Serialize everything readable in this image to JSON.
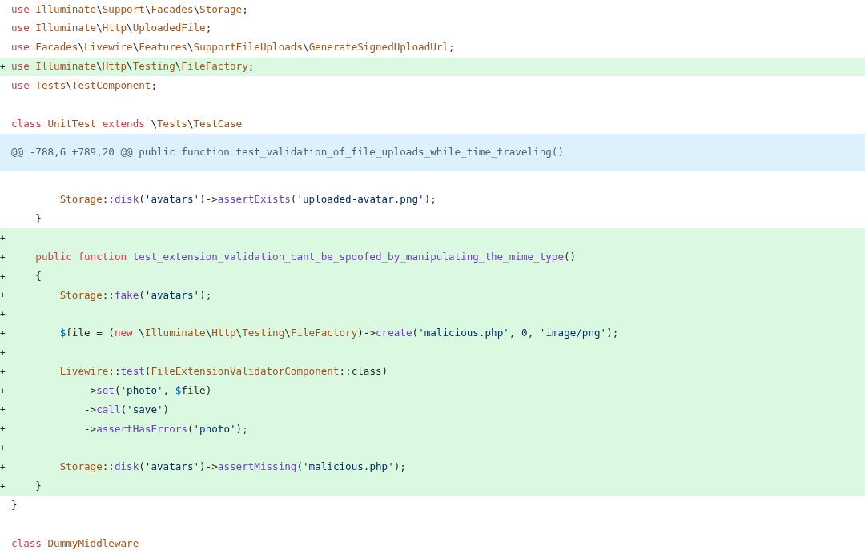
{
  "diff": {
    "lines": [
      {
        "kind": "context",
        "tokens": [
          {
            "kind": "kw",
            "text": "use"
          },
          {
            "kind": "type",
            "text": " Illuminate"
          },
          {
            "kind": "plain",
            "text": "\\"
          },
          {
            "kind": "type",
            "text": "Support"
          },
          {
            "kind": "plain",
            "text": "\\"
          },
          {
            "kind": "type",
            "text": "Facades"
          },
          {
            "kind": "plain",
            "text": "\\"
          },
          {
            "kind": "type",
            "text": "Storage"
          },
          {
            "kind": "plain",
            "text": ";"
          }
        ]
      },
      {
        "kind": "context",
        "tokens": [
          {
            "kind": "kw",
            "text": "use"
          },
          {
            "kind": "type",
            "text": " Illuminate"
          },
          {
            "kind": "plain",
            "text": "\\"
          },
          {
            "kind": "type",
            "text": "Http"
          },
          {
            "kind": "plain",
            "text": "\\"
          },
          {
            "kind": "type",
            "text": "UploadedFile"
          },
          {
            "kind": "plain",
            "text": ";"
          }
        ]
      },
      {
        "kind": "context",
        "tokens": [
          {
            "kind": "kw",
            "text": "use"
          },
          {
            "kind": "type",
            "text": " Facades"
          },
          {
            "kind": "plain",
            "text": "\\"
          },
          {
            "kind": "type",
            "text": "Livewire"
          },
          {
            "kind": "plain",
            "text": "\\"
          },
          {
            "kind": "type",
            "text": "Features"
          },
          {
            "kind": "plain",
            "text": "\\"
          },
          {
            "kind": "type",
            "text": "SupportFileUploads"
          },
          {
            "kind": "plain",
            "text": "\\"
          },
          {
            "kind": "type",
            "text": "GenerateSignedUploadUrl"
          },
          {
            "kind": "plain",
            "text": ";"
          }
        ]
      },
      {
        "kind": "added",
        "marker": "+",
        "tokens": [
          {
            "kind": "kw",
            "text": "use"
          },
          {
            "kind": "type",
            "text": " Illuminate"
          },
          {
            "kind": "plain",
            "text": "\\"
          },
          {
            "kind": "type",
            "text": "Http"
          },
          {
            "kind": "plain",
            "text": "\\"
          },
          {
            "kind": "type",
            "text": "Testing"
          },
          {
            "kind": "plain",
            "text": "\\"
          },
          {
            "kind": "type",
            "text": "FileFactory"
          },
          {
            "kind": "plain",
            "text": ";"
          }
        ]
      },
      {
        "kind": "context",
        "tokens": [
          {
            "kind": "kw",
            "text": "use"
          },
          {
            "kind": "type",
            "text": " Tests"
          },
          {
            "kind": "plain",
            "text": "\\"
          },
          {
            "kind": "type",
            "text": "TestComponent"
          },
          {
            "kind": "plain",
            "text": ";"
          }
        ]
      },
      {
        "kind": "context"
      },
      {
        "kind": "context",
        "tokens": [
          {
            "kind": "kw",
            "text": "class"
          },
          {
            "kind": "type",
            "text": " UnitTest"
          },
          {
            "kind": "kw",
            "text": " extends"
          },
          {
            "kind": "plain",
            "text": " \\"
          },
          {
            "kind": "type",
            "text": "Tests"
          },
          {
            "kind": "plain",
            "text": "\\"
          },
          {
            "kind": "type",
            "text": "TestCase"
          }
        ]
      },
      {
        "kind": "hunk",
        "tokens": [
          {
            "kind": "meta",
            "text": "@@ -788,6 +789,20 @@ public function test_validation_of_file_uploads_while_time_traveling()"
          }
        ]
      },
      {
        "kind": "context"
      },
      {
        "kind": "context",
        "tokens": [
          {
            "kind": "type",
            "text": "        Storage"
          },
          {
            "kind": "plain",
            "text": "::"
          },
          {
            "kind": "fn",
            "text": "disk"
          },
          {
            "kind": "plain",
            "text": "("
          },
          {
            "kind": "str",
            "text": "'avatars'"
          },
          {
            "kind": "plain",
            "text": ")->"
          },
          {
            "kind": "fn",
            "text": "assertExists"
          },
          {
            "kind": "plain",
            "text": "("
          },
          {
            "kind": "str",
            "text": "'uploaded-avatar.png'"
          },
          {
            "kind": "plain",
            "text": ");"
          }
        ]
      },
      {
        "kind": "context",
        "tokens": [
          {
            "kind": "plain",
            "text": "    }"
          }
        ]
      },
      {
        "kind": "added",
        "marker": "+"
      },
      {
        "kind": "added",
        "marker": "+",
        "tokens": [
          {
            "kind": "kw",
            "text": "    public"
          },
          {
            "kind": "kw",
            "text": " function"
          },
          {
            "kind": "fn",
            "text": " test_extension_validation_cant_be_spoofed_by_manipulating_the_mime_type"
          },
          {
            "kind": "plain",
            "text": "()"
          }
        ]
      },
      {
        "kind": "added",
        "marker": "+",
        "tokens": [
          {
            "kind": "plain",
            "text": "    {"
          }
        ]
      },
      {
        "kind": "added",
        "marker": "+",
        "tokens": [
          {
            "kind": "type",
            "text": "        Storage"
          },
          {
            "kind": "plain",
            "text": "::"
          },
          {
            "kind": "fn",
            "text": "fake"
          },
          {
            "kind": "plain",
            "text": "("
          },
          {
            "kind": "str",
            "text": "'avatars'"
          },
          {
            "kind": "plain",
            "text": ");"
          }
        ]
      },
      {
        "kind": "added",
        "marker": "+"
      },
      {
        "kind": "added",
        "marker": "+",
        "tokens": [
          {
            "kind": "var",
            "text": "        $"
          },
          {
            "kind": "plain",
            "text": "file = ("
          },
          {
            "kind": "kw",
            "text": "new"
          },
          {
            "kind": "plain",
            "text": " \\"
          },
          {
            "kind": "type",
            "text": "Illuminate"
          },
          {
            "kind": "plain",
            "text": "\\"
          },
          {
            "kind": "type",
            "text": "Http"
          },
          {
            "kind": "plain",
            "text": "\\"
          },
          {
            "kind": "type",
            "text": "Testing"
          },
          {
            "kind": "plain",
            "text": "\\"
          },
          {
            "kind": "type",
            "text": "FileFactory"
          },
          {
            "kind": "plain",
            "text": ")->"
          },
          {
            "kind": "fn",
            "text": "create"
          },
          {
            "kind": "plain",
            "text": "("
          },
          {
            "kind": "str",
            "text": "'malicious.php'"
          },
          {
            "kind": "plain",
            "text": ", "
          },
          {
            "kind": "str",
            "text": "0"
          },
          {
            "kind": "plain",
            "text": ", "
          },
          {
            "kind": "str",
            "text": "'image/png'"
          },
          {
            "kind": "plain",
            "text": ");"
          }
        ]
      },
      {
        "kind": "added",
        "marker": "+"
      },
      {
        "kind": "added",
        "marker": "+",
        "tokens": [
          {
            "kind": "type",
            "text": "        Livewire"
          },
          {
            "kind": "plain",
            "text": "::"
          },
          {
            "kind": "fn",
            "text": "test"
          },
          {
            "kind": "plain",
            "text": "("
          },
          {
            "kind": "type",
            "text": "FileExtensionValidatorComponent"
          },
          {
            "kind": "plain",
            "text": "::class)"
          }
        ]
      },
      {
        "kind": "added",
        "marker": "+",
        "tokens": [
          {
            "kind": "plain",
            "text": "            ->"
          },
          {
            "kind": "fn",
            "text": "set"
          },
          {
            "kind": "plain",
            "text": "("
          },
          {
            "kind": "str",
            "text": "'photo'"
          },
          {
            "kind": "plain",
            "text": ", "
          },
          {
            "kind": "var",
            "text": "$"
          },
          {
            "kind": "plain",
            "text": "file)"
          }
        ]
      },
      {
        "kind": "added",
        "marker": "+",
        "tokens": [
          {
            "kind": "plain",
            "text": "            ->"
          },
          {
            "kind": "fn",
            "text": "call"
          },
          {
            "kind": "plain",
            "text": "("
          },
          {
            "kind": "str",
            "text": "'save'"
          },
          {
            "kind": "plain",
            "text": ")"
          }
        ]
      },
      {
        "kind": "added",
        "marker": "+",
        "tokens": [
          {
            "kind": "plain",
            "text": "            ->"
          },
          {
            "kind": "fn",
            "text": "assertHasErrors"
          },
          {
            "kind": "plain",
            "text": "("
          },
          {
            "kind": "str",
            "text": "'photo'"
          },
          {
            "kind": "plain",
            "text": ");"
          }
        ]
      },
      {
        "kind": "added",
        "marker": "+"
      },
      {
        "kind": "added",
        "marker": "+",
        "tokens": [
          {
            "kind": "type",
            "text": "        Storage"
          },
          {
            "kind": "plain",
            "text": "::"
          },
          {
            "kind": "fn",
            "text": "disk"
          },
          {
            "kind": "plain",
            "text": "("
          },
          {
            "kind": "str",
            "text": "'avatars'"
          },
          {
            "kind": "plain",
            "text": ")->"
          },
          {
            "kind": "fn",
            "text": "assertMissing"
          },
          {
            "kind": "plain",
            "text": "("
          },
          {
            "kind": "str",
            "text": "'malicious.php'"
          },
          {
            "kind": "plain",
            "text": ");"
          }
        ]
      },
      {
        "kind": "added",
        "marker": "+",
        "tokens": [
          {
            "kind": "plain",
            "text": "    }"
          }
        ]
      },
      {
        "kind": "context",
        "tokens": [
          {
            "kind": "plain",
            "text": "}"
          }
        ]
      },
      {
        "kind": "context"
      },
      {
        "kind": "context",
        "tokens": [
          {
            "kind": "kw",
            "text": "class"
          },
          {
            "kind": "type",
            "text": " DummyMiddleware"
          }
        ]
      }
    ]
  }
}
